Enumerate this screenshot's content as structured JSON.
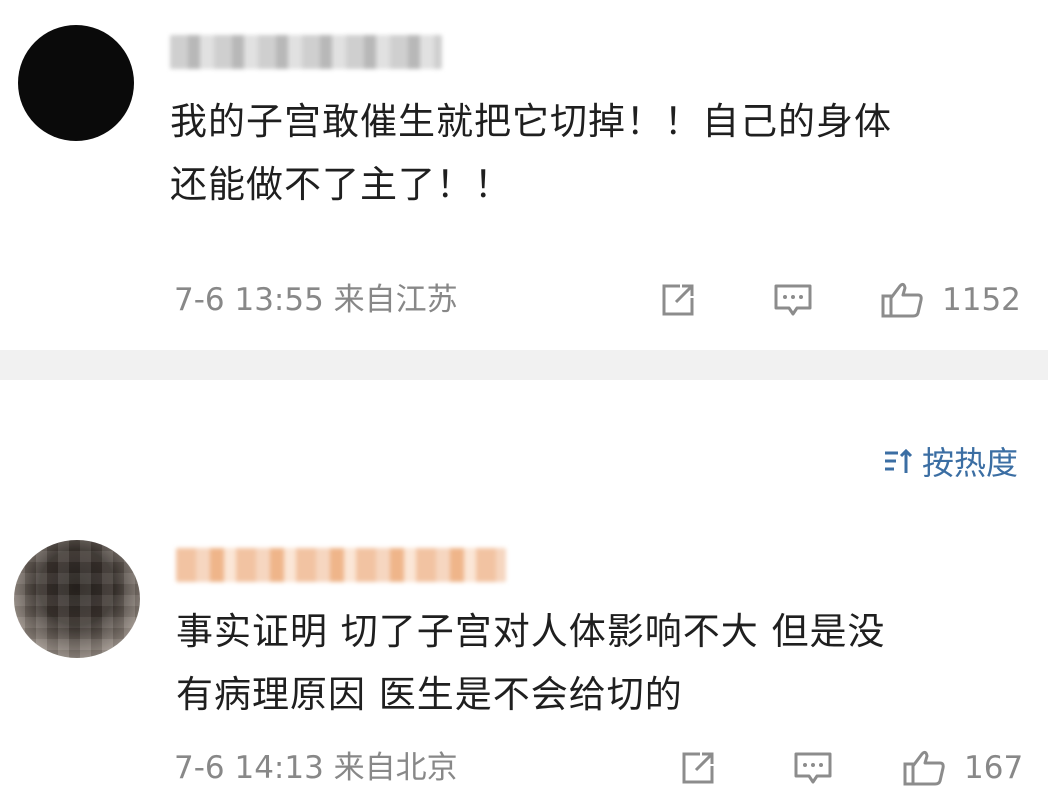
{
  "comments": [
    {
      "text_line1": "我的子宫敢催生就把它切掉！！自己的身体",
      "text_line2": "还能做不了主了！！",
      "meta": "7-6 13:55 来自江苏",
      "likes": "1152"
    },
    {
      "text_line1": "事实证明 切了子宫对人体影响不大 但是没",
      "text_line2": "有病理原因 医生是不会给切的",
      "meta": "7-6 14:13 来自北京",
      "likes": "167"
    }
  ],
  "sort": {
    "label": "按热度"
  },
  "colors": {
    "text": "#1f1f1f",
    "meta": "#888888",
    "accent": "#3b6ea3",
    "divider": "#f1f1f1"
  },
  "icons": {
    "share": "share-icon",
    "comment": "comment-icon",
    "like": "thumbs-up-icon",
    "sort": "sort-icon"
  }
}
